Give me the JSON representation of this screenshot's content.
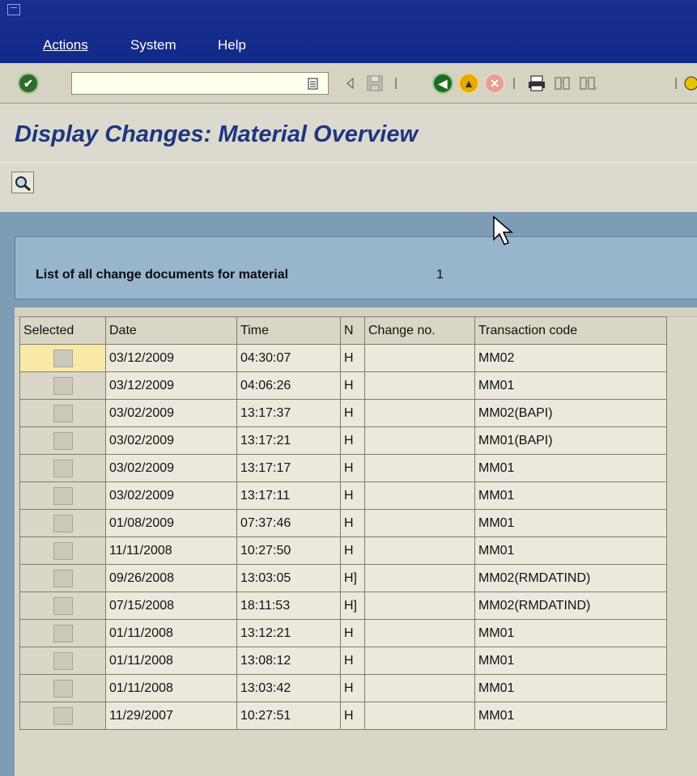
{
  "menu": [
    "Actions",
    "System",
    "Help"
  ],
  "toolbar": {
    "command_value": ""
  },
  "page_title": "Display Changes: Material Overview",
  "header": {
    "label": "List of all change documents for material",
    "material": "1"
  },
  "table": {
    "columns": [
      "Selected",
      "Date",
      "Time",
      "N",
      "Change no.",
      "Transaction code"
    ],
    "rows": [
      {
        "date": "03/12/2009",
        "time": "04:30:07",
        "n": "H",
        "change": "",
        "tcode": "MM02"
      },
      {
        "date": "03/12/2009",
        "time": "04:06:26",
        "n": "H",
        "change": "",
        "tcode": "MM01"
      },
      {
        "date": "03/02/2009",
        "time": "13:17:37",
        "n": "H",
        "change": "",
        "tcode": "MM02(BAPI)"
      },
      {
        "date": "03/02/2009",
        "time": "13:17:21",
        "n": "H",
        "change": "",
        "tcode": "MM01(BAPI)"
      },
      {
        "date": "03/02/2009",
        "time": "13:17:17",
        "n": "H",
        "change": "",
        "tcode": "MM01"
      },
      {
        "date": "03/02/2009",
        "time": "13:17:11",
        "n": "H",
        "change": "",
        "tcode": "MM01"
      },
      {
        "date": "01/08/2009",
        "time": "07:37:46",
        "n": "H",
        "change": "",
        "tcode": "MM01"
      },
      {
        "date": "11/11/2008",
        "time": "10:27:50",
        "n": "H",
        "change": "",
        "tcode": "MM01"
      },
      {
        "date": "09/26/2008",
        "time": "13:03:05",
        "n": "H]",
        "change": "",
        "tcode": "MM02(RMDATIND)"
      },
      {
        "date": "07/15/2008",
        "time": "18:11:53",
        "n": "H]",
        "change": "",
        "tcode": "MM02(RMDATIND)"
      },
      {
        "date": "01/11/2008",
        "time": "13:12:21",
        "n": "H",
        "change": "",
        "tcode": "MM01"
      },
      {
        "date": "01/11/2008",
        "time": "13:08:12",
        "n": "H",
        "change": "",
        "tcode": "MM01"
      },
      {
        "date": "01/11/2008",
        "time": "13:03:42",
        "n": "H",
        "change": "",
        "tcode": "MM01"
      },
      {
        "date": "11/29/2007",
        "time": "10:27:51",
        "n": "H",
        "change": "",
        "tcode": "MM01"
      }
    ]
  },
  "icons": {
    "app": "sap-gui-icon",
    "enter": "check-icon",
    "back": "back-icon",
    "exit": "exit-icon",
    "cancel": "cancel-icon",
    "print": "print-icon",
    "find": "find-icon",
    "find_next": "find-next-icon",
    "choose": "choose-icon"
  },
  "colors": {
    "menubar": "#1a2f8e",
    "title": "#1e3680",
    "frame": "#7e9cb4",
    "header_panel": "#97b5cb",
    "focus_cell": "#f9e9a7"
  }
}
